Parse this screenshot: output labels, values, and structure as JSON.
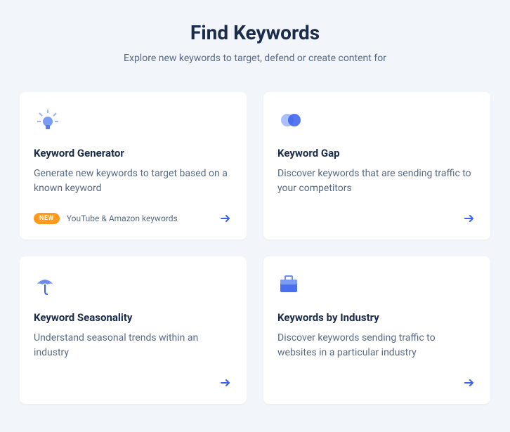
{
  "header": {
    "title": "Find Keywords",
    "subtitle": "Explore new keywords to target, defend or create content for"
  },
  "cards": [
    {
      "title": "Keyword Generator",
      "description": "Generate new keywords to target based on a known keyword",
      "badge": "NEW",
      "badge_text": "YouTube & Amazon keywords"
    },
    {
      "title": "Keyword Gap",
      "description": "Discover keywords that are sending traffic to your competitors"
    },
    {
      "title": "Keyword Seasonality",
      "description": "Understand seasonal trends within an industry"
    },
    {
      "title": "Keywords by Industry",
      "description": "Discover keywords sending traffic to websites in a particular industry"
    }
  ]
}
